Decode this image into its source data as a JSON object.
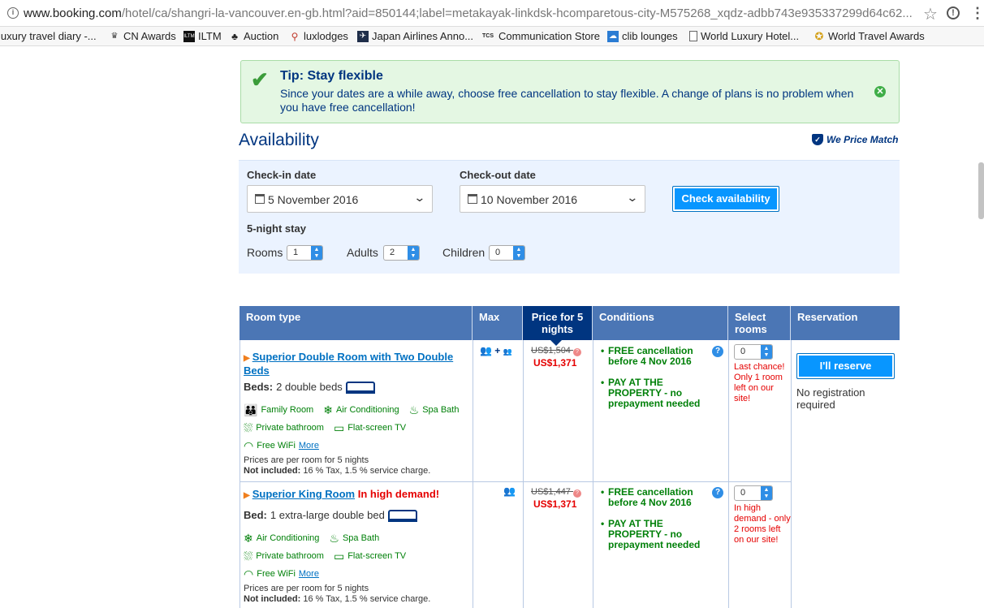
{
  "browser": {
    "url_domain": "www.booking.com",
    "url_path": "/hotel/ca/shangri-la-vancouver.en-gb.html?aid=850144;label=metakayak-linkdsk-hcomparetous-city-M575268_xqdz-adbb743e935337299d64c62...",
    "bookmarks": [
      {
        "label": "luxury travel diary -...",
        "icon": "none"
      },
      {
        "label": "CN Awards",
        "icon": "crown-icon"
      },
      {
        "label": "ILTM",
        "icon": "iltm-icon"
      },
      {
        "label": "Auction",
        "icon": "palm-icon"
      },
      {
        "label": "luxlodges",
        "icon": "kangaroo-icon"
      },
      {
        "label": "Japan Airlines Anno...",
        "icon": "plane-icon"
      },
      {
        "label": "Communication Store",
        "icon": "tcs-icon"
      },
      {
        "label": "clib lounges",
        "icon": "cloud-icon"
      },
      {
        "label": "World Luxury Hotel...",
        "icon": "document-icon"
      },
      {
        "label": "World Travel Awards",
        "icon": "award-icon"
      }
    ]
  },
  "tip": {
    "title": "Tip: Stay flexible",
    "text": "Since your dates are a while away, choose free cancellation to stay flexible. A change of plans is no problem when you have free cancellation!"
  },
  "availability": {
    "title": "Availability",
    "price_match": "We Price Match",
    "checkin_label": "Check-in date",
    "checkin_value": "5 November 2016",
    "checkout_label": "Check-out date",
    "checkout_value": "10 November 2016",
    "check_button": "Check availability",
    "stay_length": "5-night stay",
    "rooms_label": "Rooms",
    "rooms_value": "1",
    "adults_label": "Adults",
    "adults_value": "2",
    "children_label": "Children",
    "children_value": "0"
  },
  "table": {
    "headers": {
      "room_type": "Room type",
      "max": "Max",
      "price": "Price for 5 nights",
      "conditions": "Conditions",
      "select": "Select rooms",
      "reservation": "Reservation"
    },
    "reserve_button": "I'll reserve",
    "no_registration": "No registration required",
    "rooms": [
      {
        "name": "Superior Double Room with Two Double Beds",
        "demand": "",
        "beds_label": "Beds:",
        "beds_value": "2 double beds",
        "facilities": [
          "Family Room",
          "Air Conditioning",
          "Spa Bath",
          "Private bathroom",
          "Flat-screen TV",
          "Free WiFi"
        ],
        "more": "More",
        "price_note": "Prices are per room for 5 nights",
        "not_included_label": "Not included:",
        "not_included": "16 % Tax, 1.5 % service charge.",
        "old_price": "US$1,504",
        "new_price": "US$1,371",
        "conditions": [
          "FREE cancellation before 4 Nov 2016",
          "PAY AT THE PROPERTY - no prepayment needed"
        ],
        "select_value": "0",
        "scarcity": "Last chance! Only 1 room left on our site!"
      },
      {
        "name": "Superior King Room",
        "demand": "In high demand!",
        "beds_label": "Bed:",
        "beds_value": "1 extra-large double bed",
        "facilities": [
          "Air Conditioning",
          "Spa Bath",
          "Private bathroom",
          "Flat-screen TV",
          "Free WiFi"
        ],
        "more": "More",
        "price_note": "Prices are per room for 5 nights",
        "not_included_label": "Not included:",
        "not_included": "16 % Tax, 1.5 % service charge.",
        "old_price": "US$1,447",
        "new_price": "US$1,371",
        "conditions": [
          "FREE cancellation before 4 Nov 2016",
          "PAY AT THE PROPERTY - no prepayment needed"
        ],
        "select_value": "0",
        "scarcity": "In high demand - only 2 rooms left on our site!"
      }
    ]
  },
  "colors": {
    "brand_blue": "#003580",
    "header_blue": "#4b76b5",
    "button_blue": "#0896ff",
    "green": "#008009",
    "red": "#e50000"
  }
}
